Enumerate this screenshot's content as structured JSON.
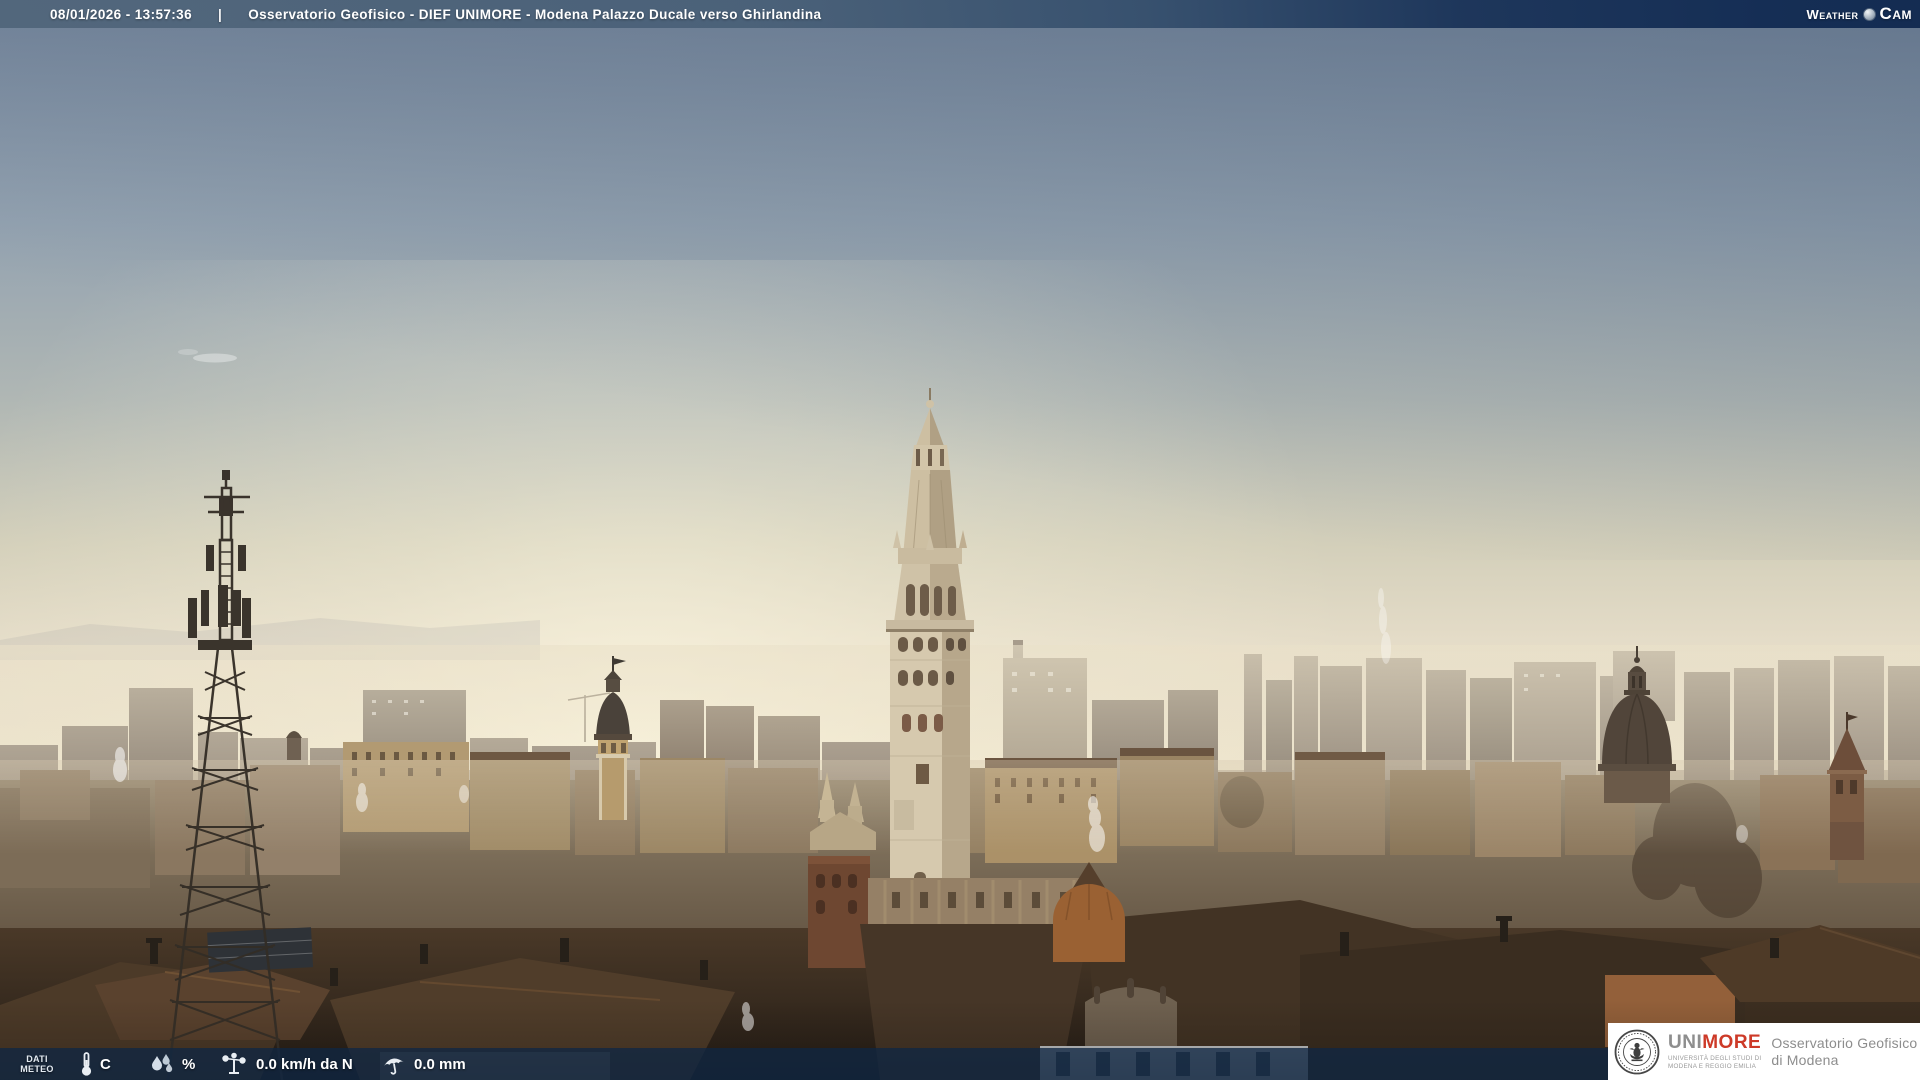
{
  "topbar": {
    "timestamp": "08/01/2026 - 13:57:36",
    "separator": "|",
    "title": "Osservatorio Geofisico - DIEF UNIMORE - Modena Palazzo Ducale verso Ghirlandina",
    "brand": {
      "word1": "Weather",
      "word2": "Cam",
      "icon": "globe-icon"
    }
  },
  "meteobar": {
    "label": {
      "line1": "DATI",
      "line2": "METEO"
    },
    "temperature": {
      "icon": "thermometer-icon",
      "value": "",
      "unit": "C"
    },
    "humidity": {
      "icon": "water-drops-icon",
      "value": "",
      "unit": "%"
    },
    "wind": {
      "icon": "anemometer-icon",
      "value": "0.0 km/h da N"
    },
    "rain": {
      "icon": "umbrella-icon",
      "value": "0.0 mm"
    }
  },
  "footer_logo": {
    "seal": "unimore-seal-icon",
    "brand_gray": "UNI",
    "brand_red": "MORE",
    "sub1": "UNIVERSITÀ DEGLI STUDI DI",
    "sub2": "MODENA E REGGIO EMILIA",
    "org1": "Osservatorio Geofisico",
    "org2": "di Modena"
  },
  "colors": {
    "topbar_left": "#4e6379",
    "topbar_right": "#152e55",
    "meteo_bar": "rgba(15,38,66,0.78)",
    "unimore_red": "#cd3a28",
    "logo_gray": "#8e8e8e",
    "sky_top": "#76879d",
    "horizon_cream": "#efe6cd"
  },
  "scene": {
    "landmarks": [
      "ghirlandina-tower",
      "telecom-tower",
      "san-domenico-dome",
      "bell-tower",
      "duomo-pinnacles",
      "city-rooftops"
    ]
  }
}
